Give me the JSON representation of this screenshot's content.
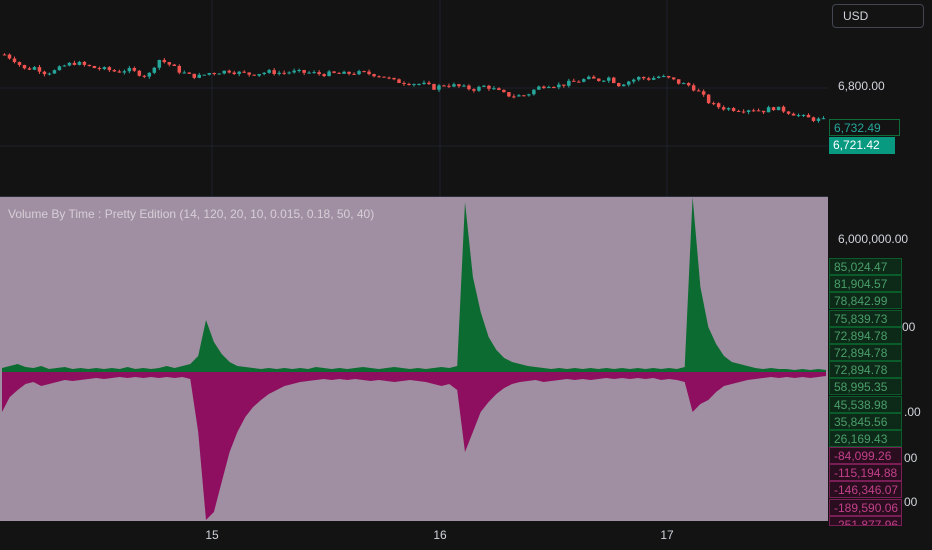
{
  "currency": "USD",
  "indicator_title": "Volume By Time : Pretty Edition (14, 120, 20, 10, 0.015, 0.18, 50, 40)",
  "price_axis": {
    "label": "6,800.00"
  },
  "price_tags": {
    "last_close": "6,732.49",
    "current": "6,721.42"
  },
  "volume_axis": {
    "top_label": "6,000,000.00",
    "partial_labels": [
      "00",
      "00",
      ".00",
      "00"
    ]
  },
  "green_tags": [
    "85,024.47",
    "81,904.57",
    "78,842.99",
    "75,839.73",
    "72,894.78",
    "72,894.78",
    "72,894.78",
    "58,995.35",
    "45,538.98",
    "35,845.56",
    "26,169.43"
  ],
  "magenta_tags": [
    "-84,099.26",
    "-115,194.88",
    "-146,346.07",
    "-189,590.06",
    "-251,877.96"
  ],
  "x_ticks": [
    "15",
    "16",
    "17"
  ],
  "colors": {
    "background": "#131313",
    "indicator_bg": "#a08fa2",
    "buy_volume": "#0c6b30",
    "sell_volume": "#8e0f5f",
    "candle_up": "#26a69a",
    "candle_down": "#ef5350"
  },
  "chart_data": [
    {
      "type": "candlestick",
      "x_ticks": [
        "15",
        "16",
        "17"
      ],
      "y_ticks": [
        "6,800.00"
      ],
      "close_path": [
        6858,
        6848,
        6832,
        6836,
        6826,
        6830,
        6840,
        6844,
        6838,
        6834,
        6832,
        6828,
        6832,
        6826,
        6820,
        6850,
        6842,
        6830,
        6822,
        6820,
        6826,
        6828,
        6830,
        6826,
        6824,
        6826,
        6828,
        6826,
        6828,
        6827,
        6826,
        6824,
        6825,
        6824,
        6826,
        6826,
        6824,
        6820,
        6812,
        6810,
        6808,
        6806,
        6800,
        6806,
        6804,
        6800,
        6798,
        6804,
        6796,
        6788,
        6786,
        6788,
        6800,
        6806,
        6804,
        6808,
        6812,
        6816,
        6814,
        6818,
        6806,
        6812,
        6818,
        6816,
        6820,
        6816,
        6808,
        6804,
        6790,
        6772,
        6766,
        6764,
        6762,
        6764,
        6760,
        6766,
        6762,
        6756,
        6750,
        6746,
        6744
      ],
      "last_close": 6732.49,
      "current": 6721.42
    },
    {
      "type": "area",
      "title": "Volume By Time : Pretty Edition (14, 120, 20, 10, 0.015, 0.18, 50, 40)",
      "y_ticks": [
        "6,000,000.00"
      ],
      "series": [
        {
          "values": [
            4,
            6,
            8,
            5,
            4,
            6,
            3,
            4,
            5,
            3,
            4,
            3,
            4,
            3,
            4,
            3,
            5,
            3,
            4,
            3,
            4,
            6,
            4,
            6,
            8,
            16,
            52,
            30,
            18,
            10,
            6,
            5,
            4,
            3,
            4,
            3,
            4,
            3,
            4,
            3,
            5,
            4,
            3,
            4,
            3,
            4,
            5,
            4,
            3,
            4,
            5,
            4,
            3,
            4,
            3,
            4,
            5,
            4,
            6,
            170,
            95,
            60,
            35,
            22,
            14,
            10,
            8,
            6,
            5,
            4,
            3,
            4,
            3,
            4,
            3,
            4,
            3,
            4,
            3,
            4,
            3,
            4,
            3,
            4,
            3,
            4,
            3,
            5,
            175,
            85,
            45,
            28,
            16,
            10,
            8,
            6,
            4,
            3,
            4,
            3,
            3,
            2,
            3,
            2,
            3,
            2
          ]
        },
        {
          "values": [
            -40,
            -25,
            -18,
            -12,
            -10,
            -14,
            -12,
            -10,
            -8,
            -9,
            -8,
            -7,
            -6,
            -7,
            -6,
            -5,
            -6,
            -5,
            -6,
            -5,
            -6,
            -5,
            -6,
            -5,
            -7,
            -60,
            -148,
            -140,
            -110,
            -80,
            -60,
            -45,
            -35,
            -28,
            -22,
            -18,
            -14,
            -12,
            -10,
            -9,
            -8,
            -7,
            -8,
            -7,
            -8,
            -7,
            -8,
            -9,
            -8,
            -9,
            -10,
            -9,
            -8,
            -9,
            -10,
            -12,
            -14,
            -12,
            -18,
            -80,
            -60,
            -40,
            -30,
            -22,
            -16,
            -12,
            -10,
            -9,
            -8,
            -10,
            -9,
            -8,
            -7,
            -8,
            -7,
            -8,
            -7,
            -6,
            -7,
            -6,
            -7,
            -6,
            -7,
            -6,
            -8,
            -7,
            -8,
            -10,
            -40,
            -32,
            -28,
            -20,
            -14,
            -12,
            -10,
            -8,
            -7,
            -6,
            -5,
            -6,
            -5,
            -6,
            -5,
            -6,
            -5,
            -4
          ]
        }
      ]
    }
  ]
}
